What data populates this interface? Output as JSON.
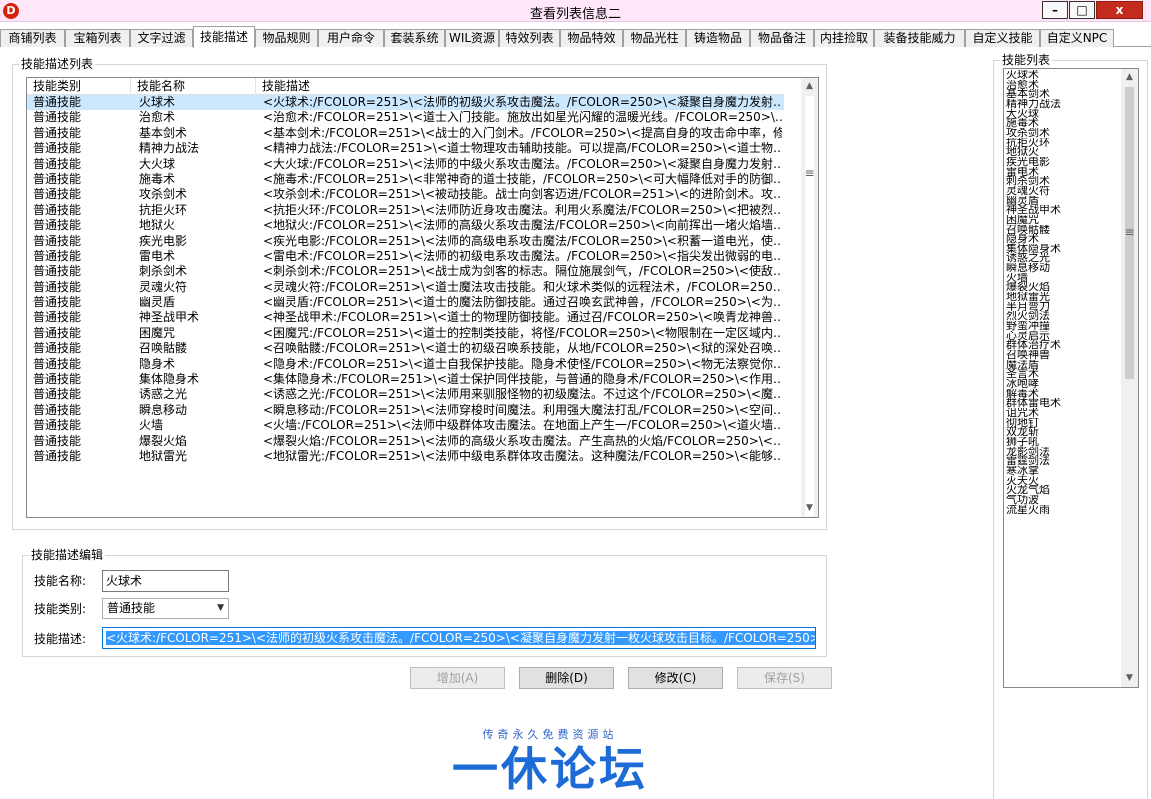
{
  "window": {
    "title": "查看列表信息二",
    "app_icon_glyph": "D",
    "minimize": "–",
    "maximize": "□",
    "close": "x"
  },
  "tabs": [
    "商铺列表",
    "宝箱列表",
    "文字过滤",
    "技能描述",
    "物品规则",
    "用户命令",
    "套装系统",
    "WIL资源",
    "特效列表",
    "物品特效",
    "物品光柱",
    "铸造物品",
    "物品备注",
    "内挂捡取",
    "装备技能威力",
    "自定义技能",
    "自定义NPC"
  ],
  "active_tab_index": 3,
  "skill_desc_list": {
    "group_label": "技能描述列表",
    "columns": [
      "技能类别",
      "技能名称",
      "技能描述"
    ],
    "rows": [
      [
        "普通技能",
        "火球术",
        "<火球术:/FCOLOR=251>\\<法师的初级火系攻击魔法。/FCOLOR=250>\\<凝聚自身魔力发射…"
      ],
      [
        "普通技能",
        "治愈术",
        "<治愈术:/FCOLOR=251>\\<道士入门技能。施放出如星光闪耀的温暖光线。/FCOLOR=250>\\…"
      ],
      [
        "普通技能",
        "基本剑术",
        "<基本剑术:/FCOLOR=251>\\<战士的入门剑术。/FCOLOR=250>\\<提高自身的攻击命中率，修…"
      ],
      [
        "普通技能",
        "精神力战法",
        "<精神力战法:/FCOLOR=251>\\<道士物理攻击辅助技能。可以提高/FCOLOR=250>\\<道士物…"
      ],
      [
        "普通技能",
        "大火球",
        "<大火球:/FCOLOR=251>\\<法师的中级火系攻击魔法。/FCOLOR=250>\\<凝聚自身魔力发射…"
      ],
      [
        "普通技能",
        "施毒术",
        "<施毒术:/FCOLOR=251>\\<非常神奇的道士技能，/FCOLOR=250>\\<可大幅降低对手的防御…"
      ],
      [
        "普通技能",
        "攻杀剑术",
        "<攻杀剑术:/FCOLOR=251>\\<被动技能。战士向剑客迈进/FCOLOR=251>\\<的进阶剑术。攻…"
      ],
      [
        "普通技能",
        "抗拒火环",
        "<抗拒火环:/FCOLOR=251>\\<法师防近身攻击魔法。利用火系魔法/FCOLOR=250>\\<把被烈…"
      ],
      [
        "普通技能",
        "地狱火",
        "<地狱火:/FCOLOR=251>\\<法师的高级火系攻击魔法/FCOLOR=250>\\<向前挥出一堵火焰墙…"
      ],
      [
        "普通技能",
        "疾光电影",
        "<疾光电影:/FCOLOR=251>\\<法师的高级电系攻击魔法/FCOLOR=250>\\<积蓄一道电光，使…"
      ],
      [
        "普通技能",
        "雷电术",
        "<雷电术:/FCOLOR=251>\\<法师的初级电系攻击魔法。/FCOLOR=250>\\<指尖发出微弱的电…"
      ],
      [
        "普通技能",
        "刺杀剑术",
        "<刺杀剑术:/FCOLOR=251>\\<战士成为剑客的标志。隔位施展剑气，/FCOLOR=250>\\<使敌…"
      ],
      [
        "普通技能",
        "灵魂火符",
        "<灵魂火符:/FCOLOR=251>\\<道士魔法攻击技能。和火球术类似的远程法术，/FCOLOR=250…"
      ],
      [
        "普通技能",
        "幽灵盾",
        "<幽灵盾:/FCOLOR=251>\\<道士的魔法防御技能。通过召唤玄武神兽，/FCOLOR=250>\\<为…"
      ],
      [
        "普通技能",
        "神圣战甲术",
        "<神圣战甲术:/FCOLOR=251>\\<道士的物理防御技能。通过召/FCOLOR=250>\\<唤青龙神兽…"
      ],
      [
        "普通技能",
        "困魔咒",
        "<困魔咒:/FCOLOR=251>\\<道士的控制类技能，将怪/FCOLOR=250>\\<物限制在一定区域内…"
      ],
      [
        "普通技能",
        "召唤骷髅",
        "<召唤骷髅:/FCOLOR=251>\\<道士的初级召唤系技能，从地/FCOLOR=250>\\<狱的深处召唤…"
      ],
      [
        "普通技能",
        "隐身术",
        "<隐身术:/FCOLOR=251>\\<道士自我保护技能。隐身术使怪/FCOLOR=250>\\<物无法察觉你…"
      ],
      [
        "普通技能",
        "集体隐身术",
        "<集体隐身术:/FCOLOR=251>\\<道士保护同伴技能，与普通的隐身术/FCOLOR=250>\\<作用…"
      ],
      [
        "普通技能",
        "诱惑之光",
        "<诱惑之光:/FCOLOR=251>\\<法师用来驯服怪物的初级魔法。不过这个/FCOLOR=250>\\<魔…"
      ],
      [
        "普通技能",
        "瞬息移动",
        "<瞬息移动:/FCOLOR=251>\\<法师穿梭时间魔法。利用强大魔法打乱/FCOLOR=250>\\<空间…"
      ],
      [
        "普通技能",
        "火墙",
        "<火墙:/FCOLOR=251>\\<法师中级群体攻击魔法。在地面上产生一/FCOLOR=250>\\<道火墙…"
      ],
      [
        "普通技能",
        "爆裂火焰",
        "<爆裂火焰:/FCOLOR=251>\\<法师的高级火系攻击魔法。产生高热的火焰/FCOLOR=250>\\<…"
      ],
      [
        "普通技能",
        "地狱雷光",
        "<地狱雷光:/FCOLOR=251>\\<法师中级电系群体攻击魔法。这种魔法/FCOLOR=250>\\<能够…"
      ]
    ],
    "selected_row": 0
  },
  "edit_group": {
    "group_label": "技能描述编辑",
    "name_label": "技能名称:",
    "name_value": "火球术",
    "type_label": "技能类别:",
    "type_value": "普通技能",
    "desc_label": "技能描述:",
    "desc_value": "<火球术:/FCOLOR=251>\\<法师的初级火系攻击魔法。/FCOLOR=250>\\<凝聚自身魔力发射一枚火球攻击目标。/FCOLOR=250>"
  },
  "buttons": {
    "add": "增加(A)",
    "delete": "删除(D)",
    "modify": "修改(C)",
    "save": "保存(S)"
  },
  "skill_list": {
    "group_label": "技能列表",
    "items": [
      "火球术",
      "治愈术",
      "基本剑术",
      "精神力战法",
      "大火球",
      "施毒术",
      "攻杀剑术",
      "抗拒火环",
      "地狱火",
      "疾光电影",
      "雷电术",
      "刺杀剑术",
      "灵魂火符",
      "幽灵盾",
      "神圣战甲术",
      "困魔咒",
      "召唤骷髅",
      "隐身术",
      "集体隐身术",
      "诱惑之光",
      "瞬息移动",
      "火墙",
      "爆裂火焰",
      "地狱雷光",
      "半月弯刀",
      "烈火剑法",
      "野蛮冲撞",
      "心灵启示",
      "群体治疗术",
      "召唤神兽",
      "魔法盾",
      "圣言术",
      "冰咆哮",
      "解毒术",
      "群体雷电术",
      "诅咒术",
      "彻地钉",
      "双龙斩",
      "狮子吼",
      "龙影剑法",
      "雷霆剑法",
      "寒冰掌",
      "灭天火",
      "火龙气焰",
      "气功波",
      "流星火雨"
    ]
  },
  "watermark": {
    "small": "传奇永久免费资源站",
    "big": "一休论坛"
  },
  "colors": {
    "title_bg": "#ffe7f9",
    "selection": "#3399ff",
    "row_selected": "#cce8ff",
    "logo_blue": "#1d6bd7"
  }
}
